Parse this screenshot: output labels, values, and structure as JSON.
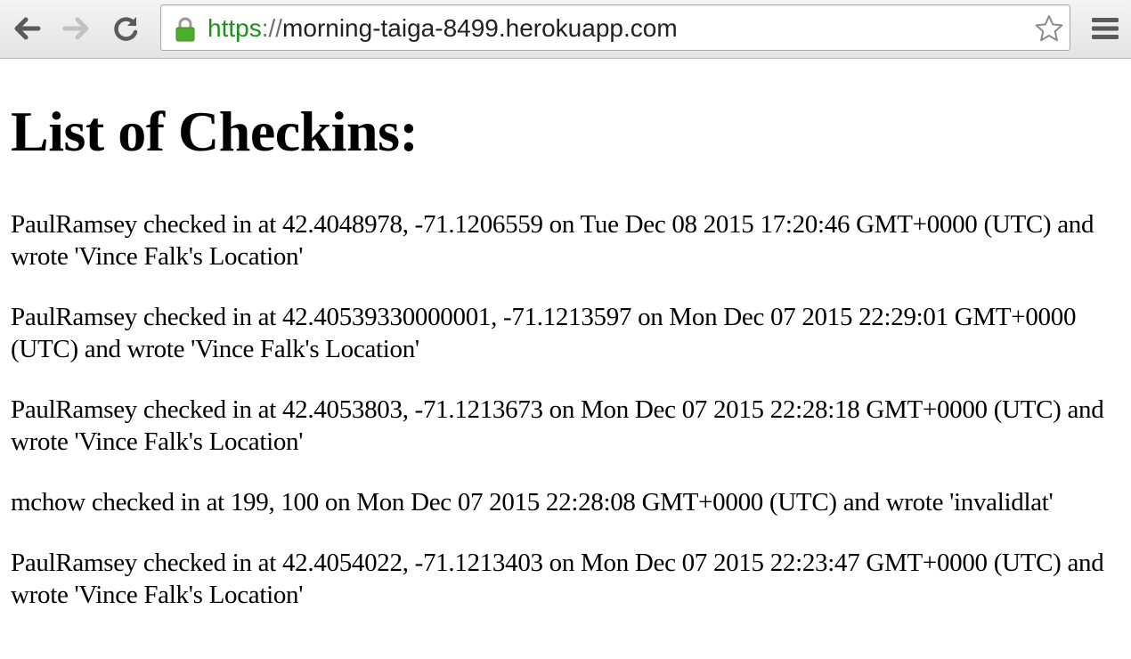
{
  "browser": {
    "url_scheme": "https",
    "url_separator": "://",
    "url_host": "morning-taiga-8499.herokuapp.com",
    "icons": {
      "back": "arrow-left-icon",
      "forward": "arrow-right-icon",
      "reload": "reload-icon",
      "lock": "lock-icon",
      "bookmark": "star-icon",
      "menu": "hamburger-menu-icon"
    },
    "colors": {
      "scheme": "#1e8f1e",
      "lock": "#4caf2c"
    }
  },
  "page": {
    "title": "List of Checkins:",
    "checkins": [
      "PaulRamsey checked in at 42.4048978, -71.1206559 on Tue Dec 08 2015 17:20:46 GMT+0000 (UTC) and wrote 'Vince Falk's Location'",
      "PaulRamsey checked in at 42.40539330000001, -71.1213597 on Mon Dec 07 2015 22:29:01 GMT+0000 (UTC) and wrote 'Vince Falk's Location'",
      "PaulRamsey checked in at 42.4053803, -71.1213673 on Mon Dec 07 2015 22:28:18 GMT+0000 (UTC) and wrote 'Vince Falk's Location'",
      "mchow checked in at 199, 100 on Mon Dec 07 2015 22:28:08 GMT+0000 (UTC) and wrote 'invalidlat'",
      "PaulRamsey checked in at 42.4054022, -71.1213403 on Mon Dec 07 2015 22:23:47 GMT+0000 (UTC) and wrote 'Vince Falk's Location'"
    ]
  }
}
